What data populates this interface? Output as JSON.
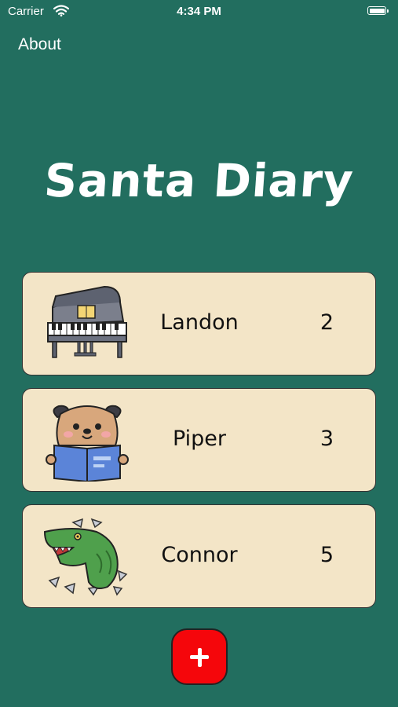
{
  "status_bar": {
    "carrier": "Carrier",
    "time": "4:34 PM"
  },
  "nav": {
    "about_label": "About"
  },
  "title": "Santa Diary",
  "children": [
    {
      "name": "Landon",
      "count": "2",
      "icon": "piano-icon"
    },
    {
      "name": "Piper",
      "count": "3",
      "icon": "puppy-reading-icon"
    },
    {
      "name": "Connor",
      "count": "5",
      "icon": "dinosaur-icon"
    }
  ],
  "add_button": {
    "icon": "plus-icon"
  },
  "colors": {
    "background": "#226e5f",
    "card": "#f3e5c7",
    "add_button": "#f5060b"
  }
}
